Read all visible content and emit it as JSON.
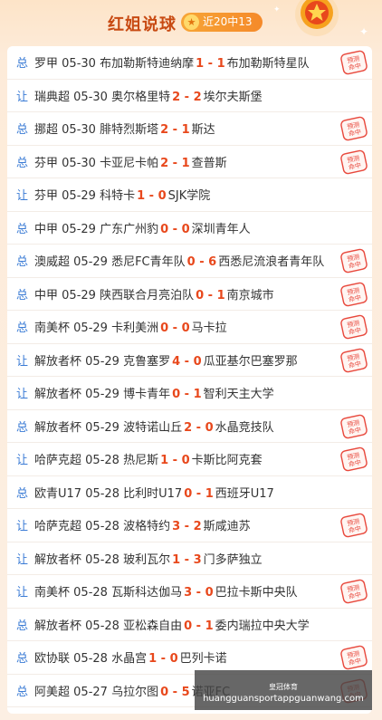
{
  "header": {
    "title": "红姐说球",
    "badge": "近20中13"
  },
  "stamp_text": "预测命中",
  "rows": [
    {
      "type": "总",
      "league": "罗甲",
      "date": "05-30",
      "home": "布加勒斯特迪纳摩",
      "hs": "1",
      "as": "1",
      "away": "布加勒斯特星队",
      "hit": true
    },
    {
      "type": "让",
      "league": "瑞典超",
      "date": "05-30",
      "home": "奥尔格里特",
      "hs": "2",
      "as": "2",
      "away": "埃尔夫斯堡",
      "hit": false
    },
    {
      "type": "总",
      "league": "挪超",
      "date": "05-30",
      "home": "腓特烈斯塔",
      "hs": "2",
      "as": "1",
      "away": "斯达",
      "hit": true
    },
    {
      "type": "总",
      "league": "芬甲",
      "date": "05-30",
      "home": "卡亚尼卡帕",
      "hs": "2",
      "as": "1",
      "away": "查普斯",
      "hit": true
    },
    {
      "type": "让",
      "league": "芬甲",
      "date": "05-29",
      "home": "科特卡",
      "hs": "1",
      "as": "0",
      "away": "SJK学院",
      "hit": false
    },
    {
      "type": "总",
      "league": "中甲",
      "date": "05-29",
      "home": "广东广州豹",
      "hs": "0",
      "as": "0",
      "away": "深圳青年人",
      "hit": false
    },
    {
      "type": "总",
      "league": "澳威超",
      "date": "05-29",
      "home": "悉尼FC青年队",
      "hs": "0",
      "as": "6",
      "away": "西悉尼流浪者青年队",
      "hit": true
    },
    {
      "type": "总",
      "league": "中甲",
      "date": "05-29",
      "home": "陕西联合月亮泊队",
      "hs": "0",
      "as": "1",
      "away": "南京城市",
      "hit": true
    },
    {
      "type": "总",
      "league": "南美杯",
      "date": "05-29",
      "home": "卡利美洲",
      "hs": "0",
      "as": "0",
      "away": "马卡拉",
      "hit": true
    },
    {
      "type": "让",
      "league": "解放者杯",
      "date": "05-29",
      "home": "克鲁塞罗",
      "hs": "4",
      "as": "0",
      "away": "瓜亚基尔巴塞罗那",
      "hit": true
    },
    {
      "type": "让",
      "league": "解放者杯",
      "date": "05-29",
      "home": "博卡青年",
      "hs": "0",
      "as": "1",
      "away": "智利天主大学",
      "hit": false
    },
    {
      "type": "总",
      "league": "解放者杯",
      "date": "05-29",
      "home": "波特诺山丘",
      "hs": "2",
      "as": "0",
      "away": "水晶竞技队",
      "hit": true
    },
    {
      "type": "让",
      "league": "哈萨克超",
      "date": "05-28",
      "home": "热尼斯",
      "hs": "1",
      "as": "0",
      "away": "卡斯比阿克套",
      "hit": true
    },
    {
      "type": "总",
      "league": "欧青U17",
      "date": "05-28",
      "home": "比利时U17",
      "hs": "0",
      "as": "1",
      "away": "西班牙U17",
      "hit": false
    },
    {
      "type": "让",
      "league": "哈萨克超",
      "date": "05-28",
      "home": "波格特约",
      "hs": "3",
      "as": "2",
      "away": "斯咸迪苏",
      "hit": true
    },
    {
      "type": "让",
      "league": "解放者杯",
      "date": "05-28",
      "home": "玻利瓦尔",
      "hs": "1",
      "as": "3",
      "away": "门多萨独立",
      "hit": false
    },
    {
      "type": "让",
      "league": "南美杯",
      "date": "05-28",
      "home": "瓦斯科达伽马",
      "hs": "3",
      "as": "0",
      "away": "巴拉卡斯中央队",
      "hit": true
    },
    {
      "type": "总",
      "league": "解放者杯",
      "date": "05-28",
      "home": "亚松森自由",
      "hs": "0",
      "as": "1",
      "away": "委内瑞拉中央大学",
      "hit": false
    },
    {
      "type": "总",
      "league": "欧协联",
      "date": "05-28",
      "home": "水晶宫",
      "hs": "1",
      "as": "0",
      "away": "巴列卡诺",
      "hit": true
    },
    {
      "type": "总",
      "league": "阿美超",
      "date": "05-27",
      "home": "乌拉尔图",
      "hs": "0",
      "as": "5",
      "away": "诺亚FC",
      "hit": true
    }
  ],
  "watermark": {
    "logo": "皇冠体育",
    "url": "huangguansportappguanwang.com"
  }
}
